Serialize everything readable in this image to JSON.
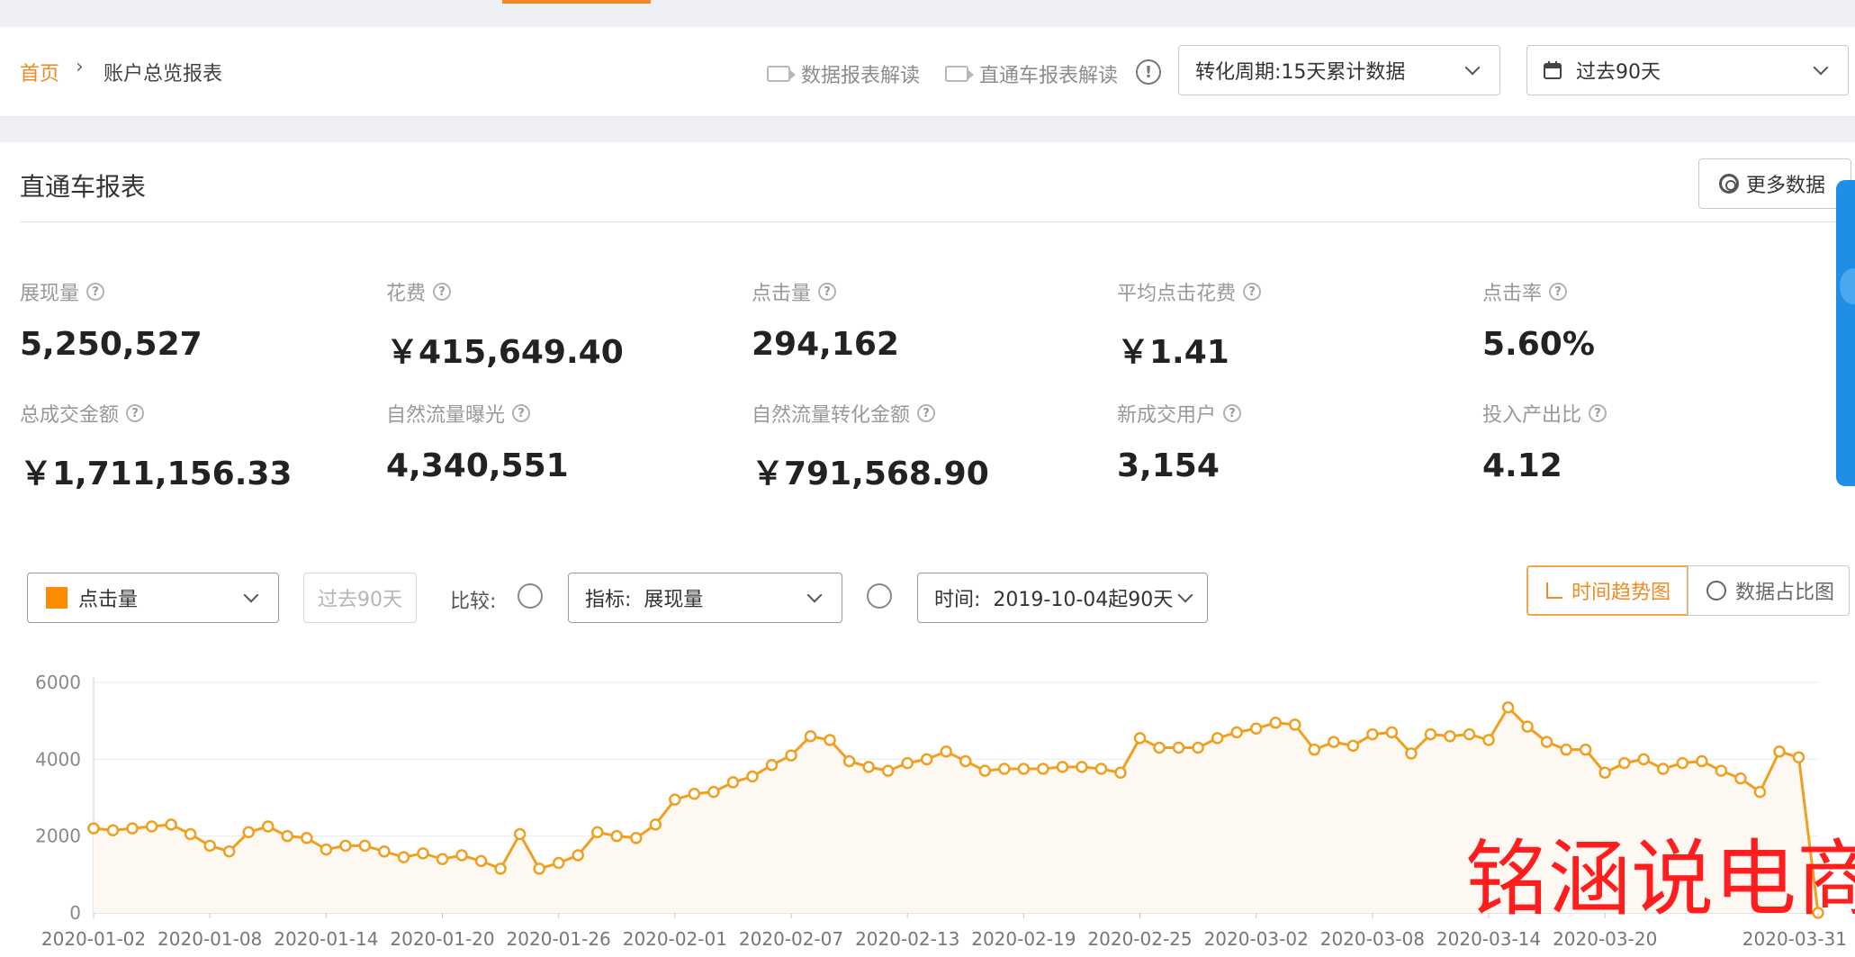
{
  "breadcrumb": {
    "home": "首页",
    "separator": "›",
    "current": "账户总览报表"
  },
  "header": {
    "link_data_report": "数据报表解读",
    "link_ztc_report": "直通车报表解读",
    "info_symbol": "!",
    "conversion_select": "转化周期:15天累计数据",
    "date_select": "过去90天",
    "calendar_icon": "calendar-icon",
    "video_icon": "video-camera-icon"
  },
  "panel": {
    "title": "直通车报表",
    "more_button": "更多数据",
    "more_icon": "gear-icon"
  },
  "metrics": [
    {
      "label": "展现量",
      "value": "5,250,527"
    },
    {
      "label": "花费",
      "value": "￥415,649.40"
    },
    {
      "label": "点击量",
      "value": "294,162"
    },
    {
      "label": "平均点击花费",
      "value": "￥1.41"
    },
    {
      "label": "点击率",
      "value": "5.60%"
    },
    {
      "label": "总成交金额",
      "value": "￥1,711,156.33"
    },
    {
      "label": "自然流量曝光",
      "value": "4,340,551"
    },
    {
      "label": "自然流量转化金额",
      "value": "￥791,568.90"
    },
    {
      "label": "新成交用户",
      "value": "3,154"
    },
    {
      "label": "投入产出比",
      "value": "4.12"
    }
  ],
  "controls": {
    "metric_select": "点击量",
    "metric_color": "#ff8c00",
    "period_placeholder": "过去90天",
    "compare_label": "比较:",
    "indicator_label": "指标:",
    "indicator_value": "展现量",
    "time_label": "时间:",
    "time_value": "2019-10-04起90天",
    "tab_trend": "时间趋势图",
    "tab_share": "数据占比图"
  },
  "chart_data": {
    "type": "area",
    "line_color": "#f0a020",
    "fill_color": "#fdf8f1",
    "ylim": [
      0,
      6000
    ],
    "y_ticks": [
      "6000",
      "4000",
      "2000",
      "0"
    ],
    "x_tick_labels": [
      "2020-01-02",
      "2020-01-08",
      "2020-01-14",
      "2020-01-20",
      "2020-01-26",
      "2020-02-01",
      "2020-02-07",
      "2020-02-13",
      "2020-02-19",
      "2020-02-25",
      "2020-03-02",
      "2020-03-08",
      "2020-03-14",
      "2020-03-20",
      "2020-03-31"
    ],
    "x_start": "2020-01-02",
    "x_end": "2020-03-31",
    "series": [
      {
        "values": [
          2200,
          2150,
          2200,
          2250,
          2300,
          2050,
          1750,
          1600,
          2100,
          2250,
          2000,
          1950,
          1650,
          1750,
          1750,
          1600,
          1450,
          1550,
          1400,
          1500,
          1350,
          1150,
          2050,
          1150,
          1300,
          1500,
          2100,
          2000,
          1950,
          2300,
          2950,
          3100,
          3150,
          3400,
          3550,
          3850,
          4100,
          4600,
          4500,
          3950,
          3800,
          3700,
          3900,
          4000,
          4200,
          3950,
          3700,
          3750,
          3750,
          3750,
          3800,
          3800,
          3750,
          3650,
          4550,
          4300,
          4300,
          4300,
          4550,
          4700,
          4800,
          4950,
          4900,
          4250,
          4450,
          4350,
          4650,
          4700,
          4150,
          4650,
          4600,
          4650,
          4500,
          5350,
          4850,
          4450,
          4250,
          4250,
          3650,
          3900,
          4000,
          3750,
          3900,
          3950,
          3700,
          3500,
          3150,
          4200,
          4050,
          0
        ]
      }
    ]
  },
  "watermark": "铭涵说电商"
}
